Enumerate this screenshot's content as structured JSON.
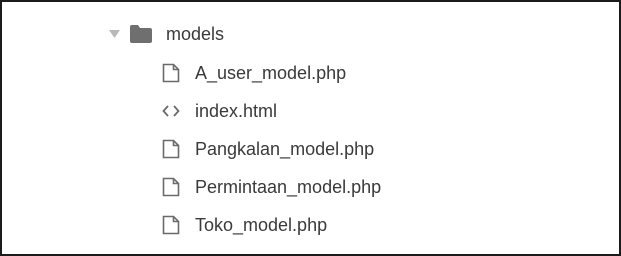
{
  "tree": {
    "folder": {
      "name": "models",
      "expanded": true,
      "caret_icon": "caret-down-icon",
      "icon": "folder-icon"
    },
    "files": [
      {
        "name": "A_user_model.php",
        "icon": "file-icon"
      },
      {
        "name": "index.html",
        "icon": "code-icon"
      },
      {
        "name": "Pangkalan_model.php",
        "icon": "file-icon"
      },
      {
        "name": "Permintaan_model.php",
        "icon": "file-icon"
      },
      {
        "name": "Toko_model.php",
        "icon": "file-icon"
      }
    ]
  },
  "colors": {
    "text": "#3a3a3a",
    "icon": "#6b6b6b",
    "folder_fill": "#6f6f6f",
    "caret": "#b9b9b9",
    "border": "#1b1b1b"
  }
}
